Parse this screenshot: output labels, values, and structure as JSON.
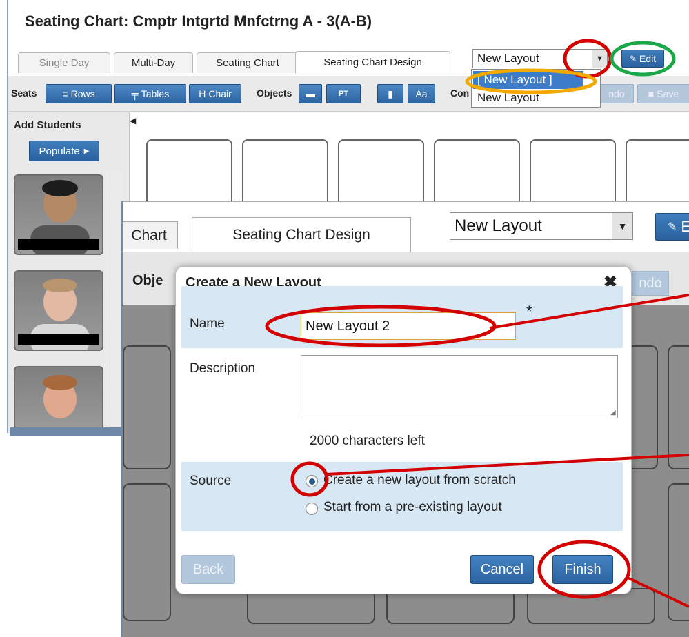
{
  "back_window": {
    "title": "Seating Chart: Cmptr Intgrtd Mnfctrng A - 3(A-B)",
    "tabs": [
      "Single Day",
      "Multi-Day",
      "Seating Chart",
      "Seating Chart Design"
    ],
    "layout_select_value": "New Layout",
    "edit_label": "Edit",
    "dropdown_options": [
      "[ New Layout ]",
      "New Layout"
    ],
    "toolbar": {
      "seats_label": "Seats",
      "rows_label": "Rows",
      "tables_label": "Tables",
      "chair_label": "Chair",
      "objects_label": "Objects",
      "pt_label": "PT",
      "aa_label": "Aa",
      "con_label": "Con",
      "undo_label": "ndo",
      "save_label": "Save"
    },
    "sidebar": {
      "header": "Add Students",
      "populate_label": "Populate"
    }
  },
  "front_window": {
    "tab_chart": "Chart",
    "tab_design": "Seating Chart Design",
    "layout_select_value": "New Layout",
    "edit_partial": "E",
    "objects_partial": "Obje",
    "undo_partial": "ndo"
  },
  "dialog": {
    "title": "Create a New Layout",
    "name_label": "Name",
    "name_value": "New Layout 2",
    "required_mark": "*",
    "description_label": "Description",
    "chars_left": "2000 characters left",
    "source_label": "Source",
    "option_scratch": "Create a new layout from scratch",
    "option_existing": "Start from a pre-existing layout",
    "back_label": "Back",
    "cancel_label": "Cancel",
    "finish_label": "Finish"
  },
  "colors": {
    "accent_blue": "#2b63a0",
    "annotation_red": "#d40000",
    "annotation_green": "#1aa848",
    "annotation_orange": "#f2a900"
  }
}
